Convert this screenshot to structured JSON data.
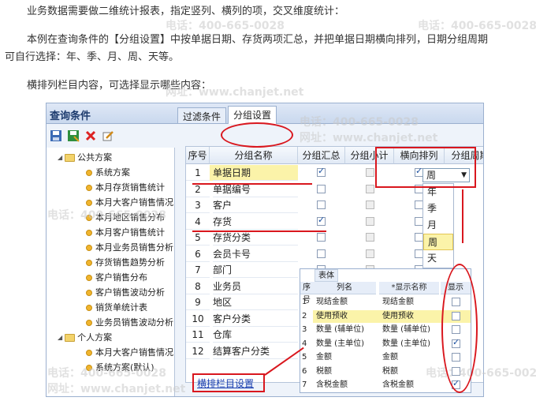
{
  "article": {
    "line1": "业务数据需要做二维统计报表，指定竖列、横列的项，交叉维度统计：",
    "line2": "本例在查询条件的【分组设置】中按单据日期、存货两项汇总，并把单据日期横向排列，日期分组周期",
    "line3": "可自行选择：年、季、月、周、天等。",
    "line4": "横排列栏目内容，可选择显示哪些内容："
  },
  "watermark": {
    "phone": "电话：400-665-0028",
    "site": "网址：www.chanjet.net"
  },
  "window": {
    "title": "查询条件"
  },
  "toolbar": {
    "icons": [
      "save-icon",
      "save-as-icon",
      "delete-icon",
      "edit-icon"
    ]
  },
  "tree": {
    "public_root": "公共方案",
    "public_items": [
      "系统方案",
      "本月存货销售统计",
      "本月大客户销售情况",
      "本月地区销售分布",
      "本月客户销售统计",
      "本月业务员销售分析",
      "存货销售趋势分析",
      "客户销售分布",
      "客户销售波动分析",
      "销货单统计表",
      "业务员销售波动分析"
    ],
    "personal_root": "个人方案",
    "personal_items": [
      "本月大客户销售情况",
      "系统方案(默认)"
    ]
  },
  "tabs": [
    "过滤条件",
    "分组设置"
  ],
  "grid": {
    "headers": [
      "序号",
      "分组名称",
      "分组汇总",
      "分组小计",
      "横向排列",
      "分组周期",
      "分"
    ],
    "rows": [
      {
        "no": "1",
        "name": "单据日期",
        "sum": true,
        "sub": false,
        "h": true,
        "period": "周"
      },
      {
        "no": "2",
        "name": "单据编号",
        "sum": false,
        "sub": false,
        "h": false,
        "period": ""
      },
      {
        "no": "3",
        "name": "客户",
        "sum": false,
        "sub": false,
        "h": false,
        "period": ""
      },
      {
        "no": "4",
        "name": "存货",
        "sum": true,
        "sub": false,
        "h": false,
        "period": ""
      },
      {
        "no": "5",
        "name": "存货分类",
        "sum": false,
        "sub": false,
        "h": false,
        "period": ""
      },
      {
        "no": "6",
        "name": "会员卡号",
        "sum": false,
        "sub": false,
        "h": false,
        "period": ""
      },
      {
        "no": "7",
        "name": "部门",
        "sum": false,
        "sub": false,
        "h": false,
        "period": ""
      },
      {
        "no": "8",
        "name": "业务员",
        "sum": false,
        "sub": false,
        "h": false,
        "period": ""
      },
      {
        "no": "9",
        "name": "地区",
        "sum": false,
        "sub": false,
        "h": false,
        "period": ""
      },
      {
        "no": "10",
        "name": "客户分类",
        "sum": false,
        "sub": false,
        "h": false,
        "period": ""
      },
      {
        "no": "11",
        "name": "仓库",
        "sum": false,
        "sub": false,
        "h": false,
        "period": ""
      },
      {
        "no": "12",
        "name": "结算客户分类",
        "sum": false,
        "sub": false,
        "h": false,
        "period": ""
      }
    ]
  },
  "period_dropdown": {
    "value": "周",
    "options": [
      "年",
      "季",
      "月",
      "周",
      "天"
    ],
    "selected": "周"
  },
  "popup": {
    "tab": "表体",
    "headers": [
      "序号",
      "列名",
      "*显示名称",
      "显示"
    ],
    "rows": [
      {
        "no": "1",
        "col": "现结金额",
        "disp": "现结金额",
        "show": false
      },
      {
        "no": "2",
        "col": "使用预收",
        "disp": "使用预收",
        "show": false
      },
      {
        "no": "3",
        "col": "数量 (辅单位)",
        "disp": "数量 (辅单位)",
        "show": false
      },
      {
        "no": "4",
        "col": "数量 (主单位)",
        "disp": "数量 (主单位)",
        "show": true
      },
      {
        "no": "5",
        "col": "金额",
        "disp": "金额",
        "show": false
      },
      {
        "no": "6",
        "col": "税额",
        "disp": "税额",
        "show": false
      },
      {
        "no": "7",
        "col": "含税金额",
        "disp": "含税金额",
        "show": true
      }
    ]
  },
  "link": "横排栏目设置",
  "colors": {
    "annotation": "#d9171e",
    "folder": "#f3d36b",
    "bullet": "#f0b52e",
    "selected_row": "#fbf3a9"
  }
}
